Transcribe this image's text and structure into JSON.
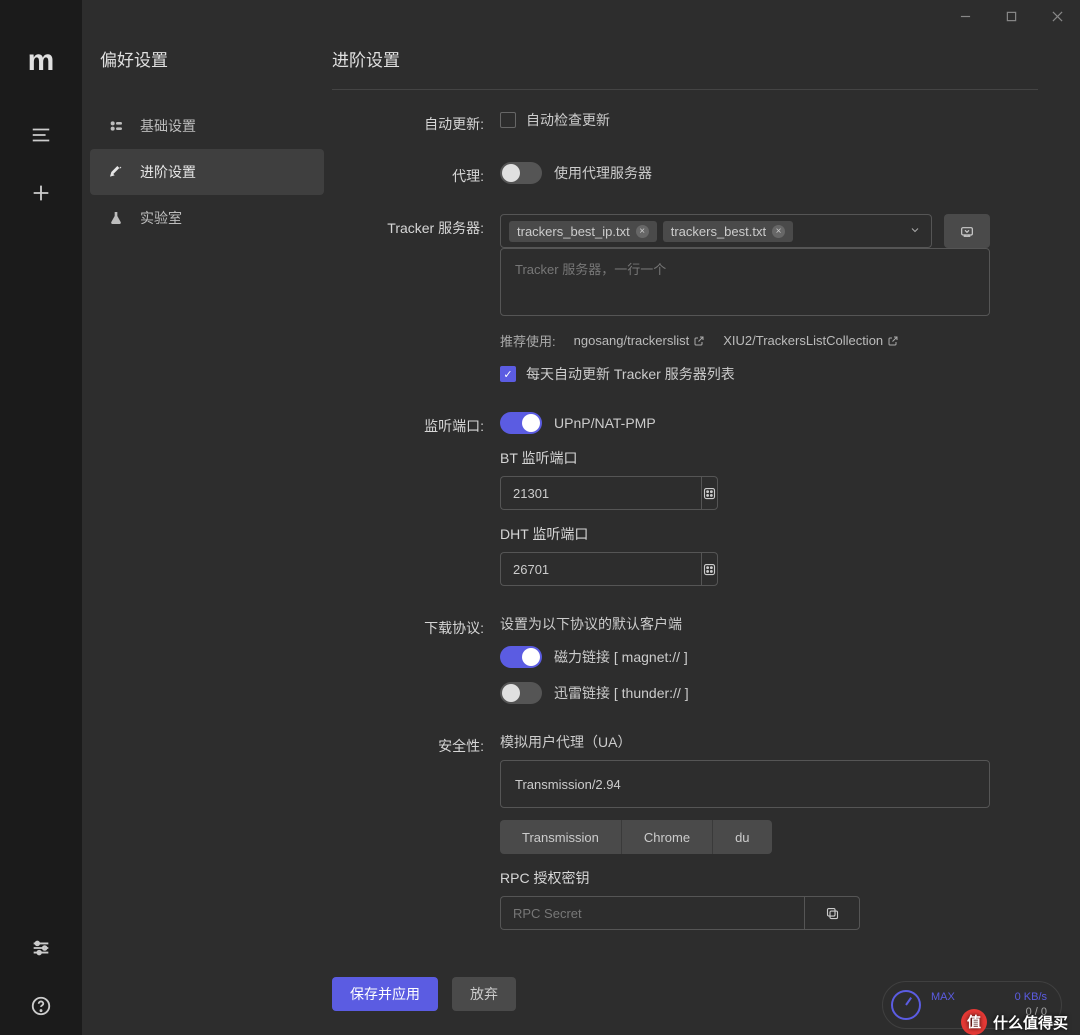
{
  "window": {
    "minimize": "–",
    "maximize": "□",
    "close": "×"
  },
  "sidebar": {
    "title": "偏好设置",
    "items": [
      {
        "label": "基础设置"
      },
      {
        "label": "进阶设置"
      },
      {
        "label": "实验室"
      }
    ]
  },
  "page": {
    "title": "进阶设置"
  },
  "form": {
    "autoUpdate": {
      "label": "自动更新:",
      "checkboxLabel": "自动检查更新",
      "checked": false
    },
    "proxy": {
      "label": "代理:",
      "toggleLabel": "使用代理服务器",
      "on": false
    },
    "tracker": {
      "label": "Tracker 服务器:",
      "tags": [
        "trackers_best_ip.txt",
        "trackers_best.txt"
      ],
      "textareaPlaceholder": "Tracker 服务器，一行一个",
      "textareaValue": "",
      "hintPrefix": "推荐使用:",
      "hintLinks": [
        "ngosang/trackerslist",
        "XIU2/TrackersListCollection"
      ],
      "dailyUpdateLabel": "每天自动更新 Tracker 服务器列表",
      "dailyUpdateChecked": true
    },
    "ports": {
      "label": "监听端口:",
      "upnpLabel": "UPnP/NAT-PMP",
      "upnpOn": true,
      "btLabel": "BT 监听端口",
      "btValue": "21301",
      "dhtLabel": "DHT 监听端口",
      "dhtValue": "26701"
    },
    "protocol": {
      "label": "下载协议:",
      "desc": "设置为以下协议的默认客户端",
      "magnetLabel": "磁力链接 [ magnet:// ]",
      "magnetOn": true,
      "thunderLabel": "迅雷链接 [ thunder:// ]",
      "thunderOn": false
    },
    "security": {
      "label": "安全性:",
      "uaLabel": "模拟用户代理（UA）",
      "uaValue": "Transmission/2.94",
      "uaPresets": [
        "Transmission",
        "Chrome",
        "du"
      ],
      "rpcLabel": "RPC 授权密钥",
      "rpcPlaceholder": "RPC Secret",
      "rpcValue": ""
    }
  },
  "footer": {
    "save": "保存并应用",
    "cancel": "放弃"
  },
  "speed": {
    "maxLabel": "MAX",
    "dlValue": "0 KB/s",
    "ulValue": "0 / 0",
    "ulUnit": ""
  },
  "watermark": {
    "badge": "值",
    "text": "什么值得买"
  }
}
